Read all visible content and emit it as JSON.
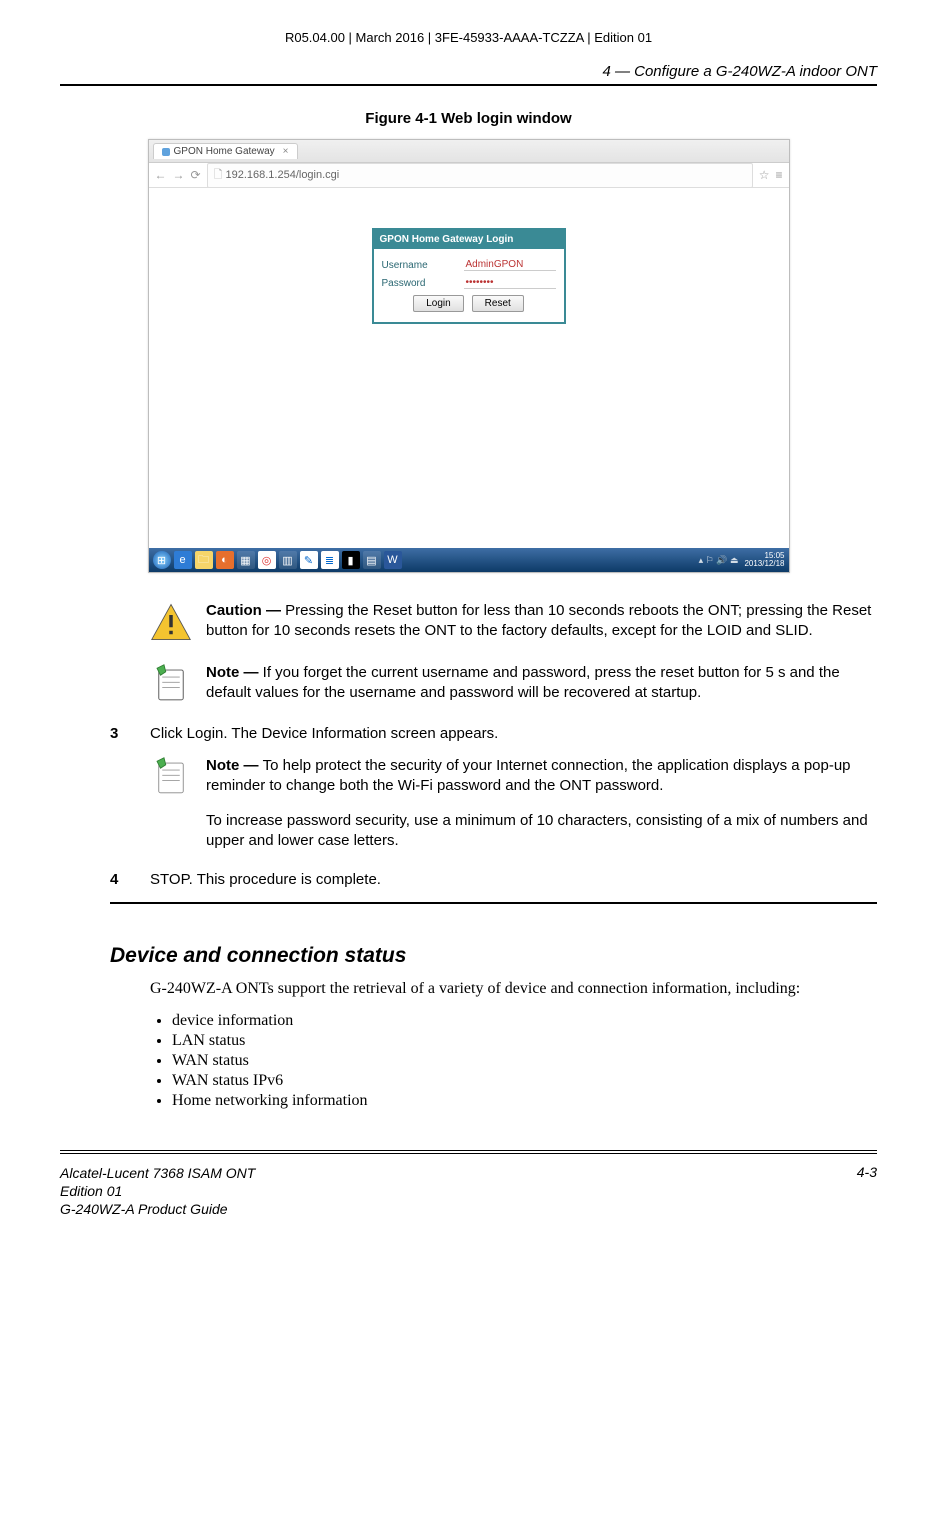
{
  "meta_line": "R05.04.00 | March 2016 | 3FE-45933-AAAA-TCZZA | Edition 01",
  "chapter_header": "4 —  Configure a G-240WZ-A indoor ONT",
  "figure_caption": "Figure 4-1  Web login window",
  "browser": {
    "tab_title": "GPON Home Gateway",
    "url": "192.168.1.254/login.cgi"
  },
  "login_box": {
    "title": "GPON Home Gateway Login",
    "username_label": "Username",
    "username_value": "AdminGPON",
    "password_label": "Password",
    "password_value": "••••••••",
    "login_btn": "Login",
    "reset_btn": "Reset"
  },
  "taskbar_time": "15:05",
  "taskbar_date": "2013/12/18",
  "caution": {
    "lead": "Caution — ",
    "text": "Pressing the Reset button for less than 10 seconds reboots the ONT; pressing the Reset button for 10 seconds resets the ONT to the factory defaults, except for the LOID and SLID."
  },
  "note1": {
    "lead": "Note — ",
    "text": "If you forget the current username and password, press the reset button for 5 s and the default values for the username and password will be recovered at startup."
  },
  "step3": {
    "num": "3",
    "text": "Click Login. The Device Information screen appears."
  },
  "note2": {
    "lead": "Note — ",
    "text": "To help protect the security of your Internet connection, the application displays a pop-up reminder to change both the Wi-Fi password and the ONT password.",
    "text2": "To increase password security, use a minimum of 10 characters, consisting of a mix of numbers and upper and lower case letters."
  },
  "step4": {
    "num": "4",
    "text": "STOP. This procedure is complete."
  },
  "section_heading": "Device and connection status",
  "section_intro": "G-240WZ-A ONTs support the retrieval of a variety of device and connection information, including:",
  "bullets": [
    "device information",
    "LAN status",
    "WAN status",
    "WAN status IPv6",
    "Home networking information"
  ],
  "footer": {
    "line1": "Alcatel-Lucent 7368 ISAM ONT",
    "line2": "Edition 01",
    "line3": "G-240WZ-A Product Guide",
    "page_num": "4-3"
  }
}
